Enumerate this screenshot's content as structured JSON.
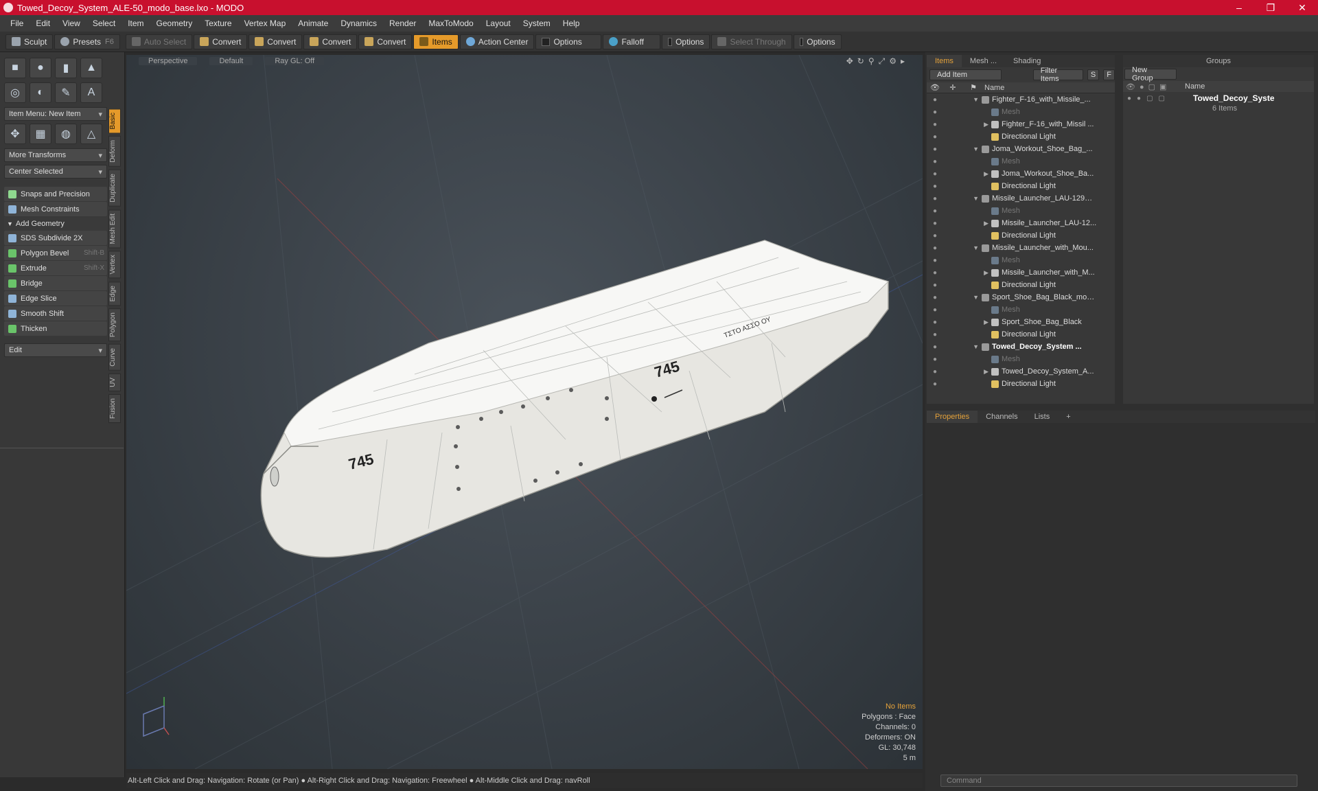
{
  "window": {
    "title": "Towed_Decoy_System_ALE-50_modo_base.lxo - MODO"
  },
  "menu": [
    "File",
    "Edit",
    "View",
    "Select",
    "Item",
    "Geometry",
    "Texture",
    "Vertex Map",
    "Animate",
    "Dynamics",
    "Render",
    "MaxToModo",
    "Layout",
    "System",
    "Help"
  ],
  "toolbar": {
    "sculpt": "Sculpt",
    "presets": "Presets",
    "presets_key": "F6",
    "auto_select": "Auto Select",
    "convert1": "Convert",
    "convert2": "Convert",
    "convert3": "Convert",
    "convert4": "Convert",
    "items": "Items",
    "action_center": "Action Center",
    "options1": "Options",
    "falloff": "Falloff",
    "options2": "Options",
    "select_through": "Select Through",
    "options3": "Options"
  },
  "left": {
    "item_menu": "Item Menu: New Item",
    "more_transforms": "More Transforms",
    "center_selected": "Center Selected",
    "snaps": "Snaps and Precision",
    "mesh_constraints": "Mesh Constraints",
    "add_geometry": "Add Geometry",
    "tools": [
      {
        "label": "SDS Subdivide 2X",
        "key": ""
      },
      {
        "label": "Polygon Bevel",
        "key": "Shift-B"
      },
      {
        "label": "Extrude",
        "key": "Shift-X"
      },
      {
        "label": "Bridge",
        "key": ""
      },
      {
        "label": "Edge Slice",
        "key": ""
      },
      {
        "label": "Smooth Shift",
        "key": ""
      },
      {
        "label": "Thicken",
        "key": ""
      }
    ],
    "edit": "Edit",
    "vtabs": [
      "Basic",
      "Deform",
      "Duplicate",
      "Mesh Edit",
      "Vertex",
      "Edge",
      "Polygon",
      "Curve",
      "UV",
      "Fusion"
    ]
  },
  "viewport": {
    "perspective": "Perspective",
    "default": "Default",
    "raygl": "Ray GL: Off",
    "decal_main": "745",
    "decal_side": "745",
    "decal_small": "ΤΣΤΟ ΑΣΣΟ ΟΥ",
    "stats": {
      "no_items": "No Items",
      "polygons": "Polygons : Face",
      "channels": "Channels: 0",
      "deformers": "Deformers: ON",
      "gl": "GL: 30,748",
      "scale": "5 m"
    }
  },
  "status": {
    "hint": "Alt-Left Click and Drag: Navigation: Rotate (or Pan) ● Alt-Right Click and Drag: Navigation: Freewheel ● Alt-Middle Click and Drag: navRoll"
  },
  "items_panel": {
    "tabs": [
      "Items",
      "Mesh ...",
      "Shading"
    ],
    "add_item": "Add Item",
    "filter": "Filter Items",
    "s": "S",
    "f": "F",
    "col_name": "Name",
    "rows": [
      {
        "label": "Fighter_F-16_with_Missile_...",
        "indent": 0,
        "kind": "scene"
      },
      {
        "label": "Mesh",
        "indent": 1,
        "kind": "mesh"
      },
      {
        "label": "Fighter_F-16_with_Missil ...",
        "indent": 1,
        "kind": "group"
      },
      {
        "label": "Directional Light",
        "indent": 1,
        "kind": "light"
      },
      {
        "label": "Joma_Workout_Shoe_Bag_...",
        "indent": 0,
        "kind": "scene"
      },
      {
        "label": "Mesh",
        "indent": 1,
        "kind": "mesh"
      },
      {
        "label": "Joma_Workout_Shoe_Ba...",
        "indent": 1,
        "kind": "group"
      },
      {
        "label": "Directional Light",
        "indent": 1,
        "kind": "light"
      },
      {
        "label": "Missile_Launcher_LAU-129_...",
        "indent": 0,
        "kind": "scene"
      },
      {
        "label": "Mesh",
        "indent": 1,
        "kind": "mesh"
      },
      {
        "label": "Missile_Launcher_LAU-12...",
        "indent": 1,
        "kind": "group"
      },
      {
        "label": "Directional Light",
        "indent": 1,
        "kind": "light"
      },
      {
        "label": "Missile_Launcher_with_Mou...",
        "indent": 0,
        "kind": "scene"
      },
      {
        "label": "Mesh",
        "indent": 1,
        "kind": "mesh"
      },
      {
        "label": "Missile_Launcher_with_M...",
        "indent": 1,
        "kind": "group"
      },
      {
        "label": "Directional Light",
        "indent": 1,
        "kind": "light"
      },
      {
        "label": "Sport_Shoe_Bag_Black_mo ...",
        "indent": 0,
        "kind": "scene"
      },
      {
        "label": "Mesh",
        "indent": 1,
        "kind": "mesh"
      },
      {
        "label": "Sport_Shoe_Bag_Black",
        "indent": 1,
        "kind": "group"
      },
      {
        "label": "Directional Light",
        "indent": 1,
        "kind": "light"
      },
      {
        "label": "Towed_Decoy_System ...",
        "indent": 0,
        "kind": "scene",
        "bold": true
      },
      {
        "label": "Mesh",
        "indent": 1,
        "kind": "mesh"
      },
      {
        "label": "Towed_Decoy_System_A...",
        "indent": 1,
        "kind": "group"
      },
      {
        "label": "Directional Light",
        "indent": 1,
        "kind": "light"
      }
    ]
  },
  "groups_panel": {
    "title": "Groups",
    "new_group": "New Group",
    "col_name": "Name",
    "group_name": "Towed_Decoy_Syste",
    "group_count": "6 Items"
  },
  "props_panel": {
    "tabs": [
      "Properties",
      "Channels",
      "Lists",
      "+"
    ]
  },
  "command": {
    "placeholder": "Command"
  },
  "colors": {
    "title_bg": "#c8102e",
    "accent": "#e59a2a"
  }
}
